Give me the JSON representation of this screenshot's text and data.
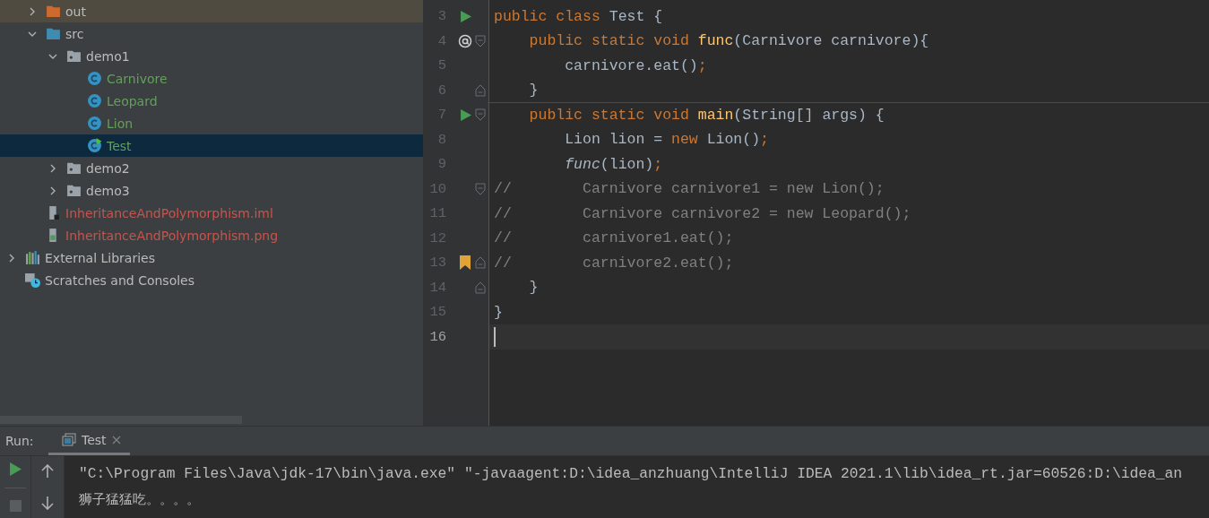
{
  "project_tree": [
    {
      "kind": "hidden-root",
      "children": [
        {
          "label": "out",
          "kind": "excluded-folder",
          "expanded": false,
          "selected": false
        },
        {
          "label": "src",
          "kind": "source-folder",
          "expanded": true,
          "selected": false,
          "children": [
            {
              "label": "demo1",
              "kind": "package",
              "expanded": true,
              "selected": false,
              "children": [
                {
                  "label": "Carnivore",
                  "kind": "class",
                  "selected": false,
                  "color": "#62a05b"
                },
                {
                  "label": "Leopard",
                  "kind": "class",
                  "selected": false,
                  "color": "#62a05b"
                },
                {
                  "label": "Lion",
                  "kind": "class",
                  "selected": false,
                  "color": "#62a05b"
                },
                {
                  "label": "Test",
                  "kind": "main-class",
                  "selected": true,
                  "color": "#62a05b"
                }
              ]
            },
            {
              "label": "demo2",
              "kind": "package",
              "expanded": false,
              "selected": false
            },
            {
              "label": "demo3",
              "kind": "package",
              "expanded": false,
              "selected": false
            }
          ]
        },
        {
          "label": "InheritanceAndPolymorphism.iml",
          "kind": "module-file",
          "selected": false,
          "color": "#c7544c"
        },
        {
          "label": "InheritanceAndPolymorphism.png",
          "kind": "image-file",
          "selected": false,
          "color": "#c7544c"
        }
      ]
    },
    {
      "label": "External Libraries",
      "kind": "libraries",
      "expanded": false,
      "selected": false
    },
    {
      "label": "Scratches and Consoles",
      "kind": "scratches",
      "selected": false
    }
  ],
  "editor": {
    "lines": [
      {
        "number": "3",
        "gutter": {
          "kind": "run"
        },
        "current": false,
        "tokens": [
          {
            "kind": "keyword",
            "text": "public class "
          },
          {
            "kind": "plain",
            "text": "Test {"
          }
        ]
      },
      {
        "number": "4",
        "gutter": {
          "kind": "override"
        },
        "fold": {
          "kind": "start"
        },
        "current": false,
        "tokens": [
          {
            "kind": "keyword",
            "text": "    public static void "
          },
          {
            "kind": "method",
            "text": "func"
          },
          {
            "kind": "plain",
            "text": "(Carnivore carnivore){"
          }
        ]
      },
      {
        "number": "5",
        "current": false,
        "tokens": [
          {
            "kind": "plain",
            "text": "        carnivore.eat()"
          },
          {
            "kind": "keyword",
            "text": ";"
          }
        ]
      },
      {
        "number": "6",
        "fold": {
          "kind": "end"
        },
        "separator_below": true,
        "current": false,
        "tokens": [
          {
            "kind": "plain",
            "text": "    }"
          }
        ]
      },
      {
        "number": "7",
        "gutter": {
          "kind": "run"
        },
        "fold": {
          "kind": "start"
        },
        "current": false,
        "tokens": [
          {
            "kind": "keyword",
            "text": "    public static void "
          },
          {
            "kind": "method",
            "text": "main"
          },
          {
            "kind": "plain",
            "text": "(String[] args) {"
          }
        ]
      },
      {
        "number": "8",
        "current": false,
        "tokens": [
          {
            "kind": "plain",
            "text": "        Lion lion = "
          },
          {
            "kind": "keyword",
            "text": "new "
          },
          {
            "kind": "plain",
            "text": "Lion()"
          },
          {
            "kind": "keyword",
            "text": ";"
          }
        ]
      },
      {
        "number": "9",
        "current": false,
        "tokens": [
          {
            "kind": "static-call",
            "text": "        func"
          },
          {
            "kind": "plain",
            "text": "(lion)"
          },
          {
            "kind": "keyword",
            "text": ";"
          }
        ]
      },
      {
        "number": "10",
        "fold": {
          "kind": "start"
        },
        "current": false,
        "tokens": [
          {
            "kind": "comment",
            "text": "//        Carnivore carnivore1 = new Lion();"
          }
        ]
      },
      {
        "number": "11",
        "current": false,
        "tokens": [
          {
            "kind": "comment",
            "text": "//        Carnivore carnivore2 = new Leopard();"
          }
        ]
      },
      {
        "number": "12",
        "current": false,
        "tokens": [
          {
            "kind": "comment",
            "text": "//        carnivore1.eat();"
          }
        ]
      },
      {
        "number": "13",
        "gutter": {
          "kind": "bookmark"
        },
        "fold": {
          "kind": "end"
        },
        "current": false,
        "tokens": [
          {
            "kind": "comment",
            "text": "//        carnivore2.eat();"
          }
        ]
      },
      {
        "number": "14",
        "fold": {
          "kind": "end"
        },
        "current": false,
        "tokens": [
          {
            "kind": "plain",
            "text": "    }"
          }
        ]
      },
      {
        "number": "15",
        "current": false,
        "tokens": [
          {
            "kind": "plain",
            "text": "}"
          }
        ]
      },
      {
        "number": "16",
        "current": true
      }
    ]
  },
  "run_panel": {
    "label": "Run:",
    "tabs": [
      {
        "label": "Test",
        "selected": true,
        "closable": true
      }
    ],
    "console_lines": [
      "\"C:\\Program Files\\Java\\jdk-17\\bin\\java.exe\" \"-javaagent:D:\\idea_anzhuang\\IntelliJ IDEA 2021.1\\lib\\idea_rt.jar=60526:D:\\idea_an",
      "狮子猛猛吃。。。。"
    ]
  }
}
